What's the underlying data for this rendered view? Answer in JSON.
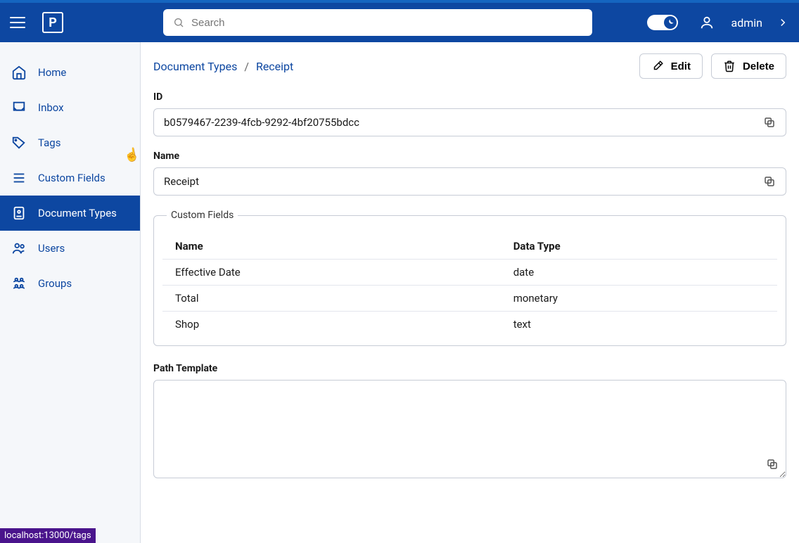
{
  "header": {
    "search_placeholder": "Search",
    "username": "admin"
  },
  "sidebar": {
    "items": [
      {
        "key": "home",
        "label": "Home",
        "icon": "home"
      },
      {
        "key": "inbox",
        "label": "Inbox",
        "icon": "inbox"
      },
      {
        "key": "tags",
        "label": "Tags",
        "icon": "tag"
      },
      {
        "key": "custom-fields",
        "label": "Custom Fields",
        "icon": "list"
      },
      {
        "key": "document-types",
        "label": "Document Types",
        "icon": "doc"
      },
      {
        "key": "users",
        "label": "Users",
        "icon": "users"
      },
      {
        "key": "groups",
        "label": "Groups",
        "icon": "groups"
      }
    ],
    "active": "document-types"
  },
  "breadcrumb": {
    "parent": "Document Types",
    "current": "Receipt",
    "separator": "/"
  },
  "actions": {
    "edit_label": "Edit",
    "delete_label": "Delete"
  },
  "fields": {
    "id_label": "ID",
    "id_value": "b0579467-2239-4fcb-9292-4bf20755bdcc",
    "name_label": "Name",
    "name_value": "Receipt",
    "path_template_label": "Path Template",
    "path_template_value": ""
  },
  "custom_fields": {
    "legend": "Custom Fields",
    "headers": {
      "name": "Name",
      "data_type": "Data Type"
    },
    "rows": [
      {
        "name": "Effective Date",
        "data_type": "date"
      },
      {
        "name": "Total",
        "data_type": "monetary"
      },
      {
        "name": "Shop",
        "data_type": "text"
      }
    ]
  },
  "status_bar": "localhost:13000/tags"
}
